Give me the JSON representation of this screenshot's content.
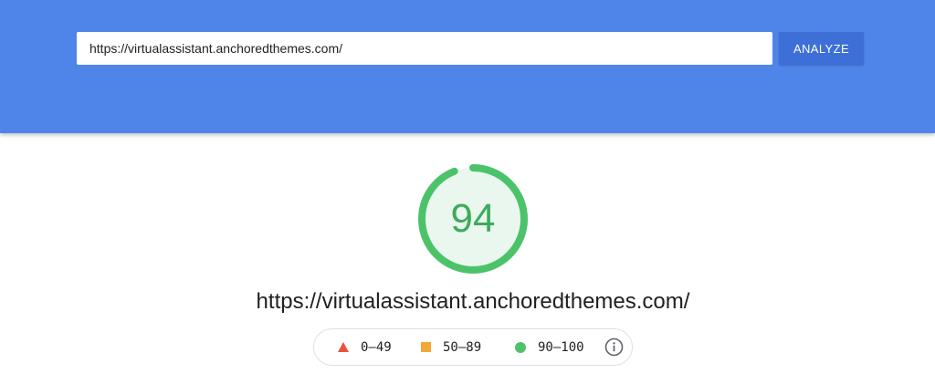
{
  "header": {
    "url_value": "https://virtualassistant.anchoredthemes.com/",
    "analyze_label": "ANALYZE"
  },
  "report": {
    "score": "94",
    "score_fraction": 0.94,
    "score_color": "#3dab5b",
    "ring_color": "#4cc36a",
    "ring_bg": "#eaf7ee",
    "url": "https://virtualassistant.anchoredthemes.com/"
  },
  "legend": {
    "fail": {
      "icon": "red-triangle-icon",
      "label": "0–49",
      "color": "#e8533f"
    },
    "average": {
      "icon": "orange-square-icon",
      "label": "50–89",
      "color": "#f4a83a"
    },
    "pass": {
      "icon": "green-circle-icon",
      "label": "90–100",
      "color": "#4cc36a"
    },
    "info_icon": "info-icon"
  }
}
